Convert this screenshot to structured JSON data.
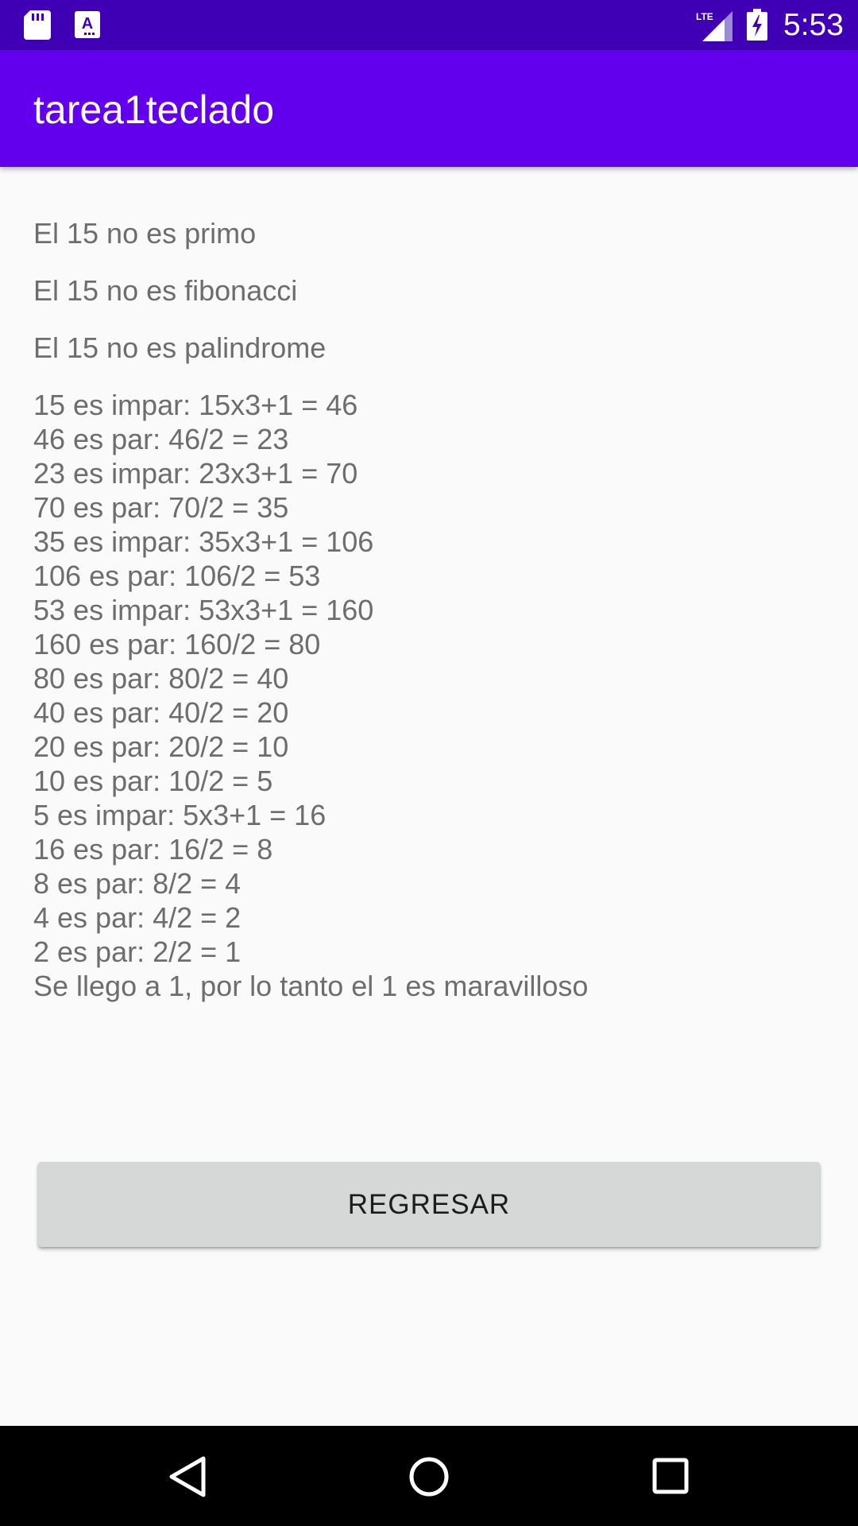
{
  "status_bar": {
    "time": "5:53",
    "network_label": "LTE",
    "icons": [
      "sd-card-icon",
      "a-notification-icon",
      "lte-signal-icon",
      "battery-charging-icon"
    ]
  },
  "app_bar": {
    "title": "tarea1teclado"
  },
  "results": {
    "primo": "El 15 no es primo",
    "fibonacci": "El 15 no es fibonacci",
    "palindrome": "El 15 no es palindrome"
  },
  "collatz_lines": [
    "15 es impar: 15x3+1 = 46",
    "46 es par: 46/2 = 23",
    "23 es impar: 23x3+1 = 70",
    "70 es par: 70/2 = 35",
    "35 es impar: 35x3+1 = 106",
    "106 es par: 106/2 = 53",
    "53 es impar: 53x3+1 = 160",
    "160 es par: 160/2 = 80",
    "80 es par: 80/2 = 40",
    "40 es par: 40/2 = 20",
    "20 es par: 20/2 = 10",
    "10 es par: 10/2 = 5",
    "5 es impar: 5x3+1 = 16",
    "16 es par: 16/2 = 8",
    "8 es par: 8/2 = 4",
    "4 es par: 4/2 = 2",
    "2 es par: 2/2 = 1",
    "Se llego a 1, por lo tanto el 1 es maravilloso"
  ],
  "button": {
    "label": "REGRESAR"
  },
  "nav_bar": {
    "icons": [
      "back-icon",
      "home-icon",
      "recents-icon"
    ]
  },
  "colors": {
    "status_bar": "#3f00b5",
    "app_bar": "#6200ee",
    "background": "#fafafa",
    "button": "#d6d7d7"
  }
}
